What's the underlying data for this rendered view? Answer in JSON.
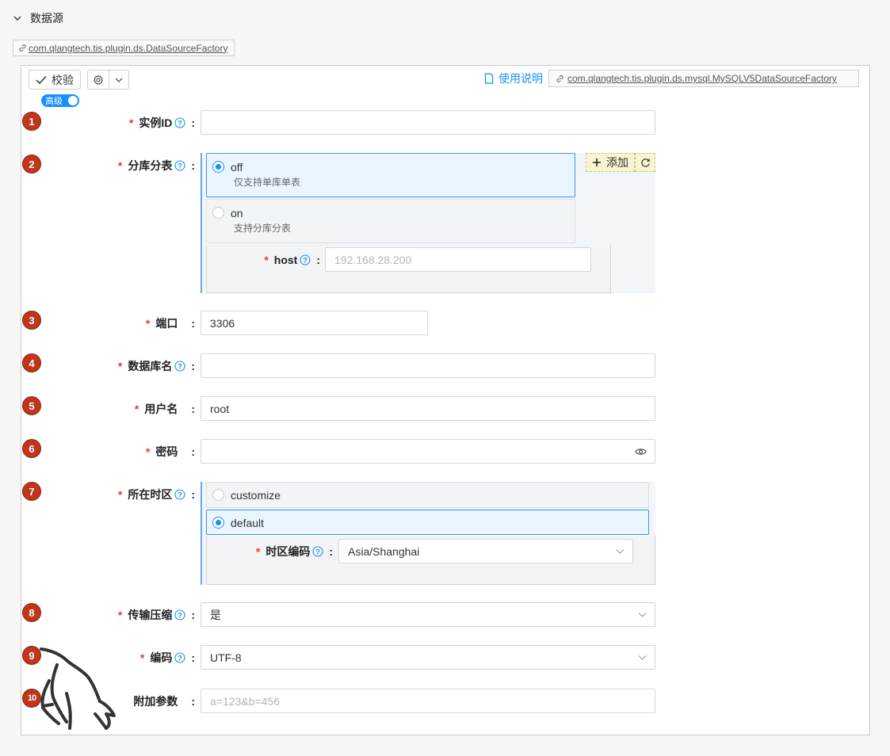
{
  "section": {
    "title": "数据源"
  },
  "factory_tag": "com.qlangtech.tis.plugin.ds.DataSourceFactory",
  "toolbar": {
    "validate_label": "校验",
    "doc_link": "使用说明",
    "plugin_tag": "com.qlangtech.tis.plugin.ds.mysql.MySQLV5DataSourceFactory",
    "advanced_label": "高级",
    "advanced_on": true
  },
  "fields": {
    "instance_id": {
      "label": "实例ID",
      "required": true,
      "badge": "1",
      "value": ""
    },
    "sharding": {
      "label": "分库分表",
      "required": true,
      "badge": "2",
      "options": [
        {
          "title": "off",
          "desc": "仅支持单库单表",
          "selected": true
        },
        {
          "title": "on",
          "desc": "支持分库分表",
          "selected": false
        }
      ],
      "add_label": "添加",
      "host": {
        "label": "host",
        "placeholder": "192.168.28.200"
      }
    },
    "port": {
      "label": "端口",
      "required": true,
      "badge": "3",
      "value": "3306"
    },
    "db_name": {
      "label": "数据库名",
      "required": true,
      "badge": "4",
      "value": ""
    },
    "username": {
      "label": "用户名",
      "required": true,
      "badge": "5",
      "value": "root"
    },
    "password": {
      "label": "密码",
      "required": true,
      "badge": "6",
      "value": ""
    },
    "timezone": {
      "label": "所在时区",
      "required": true,
      "badge": "7",
      "options": [
        {
          "title": "customize",
          "selected": false
        },
        {
          "title": "default",
          "selected": true
        }
      ],
      "tz_code": {
        "label": "时区编码",
        "value": "Asia/Shanghai"
      }
    },
    "compress": {
      "label": "传输压缩",
      "required": true,
      "badge": "8",
      "value": "是"
    },
    "encoding": {
      "label": "编码",
      "required": true,
      "badge": "9",
      "value": "UTF-8"
    },
    "extra_params": {
      "label": "附加参数",
      "required": false,
      "badge": "10",
      "placeholder": "a=123&b=456"
    }
  },
  "colors": {
    "accent": "#1890ff",
    "badge": "#c0361a",
    "required": "#e53935"
  },
  "icons": [
    "chevron-down-icon",
    "link-icon",
    "check-icon",
    "gear-icon",
    "book-icon",
    "help-icon",
    "plus-icon",
    "refresh-icon",
    "eye-icon",
    "mysql-dolphin-icon"
  ]
}
